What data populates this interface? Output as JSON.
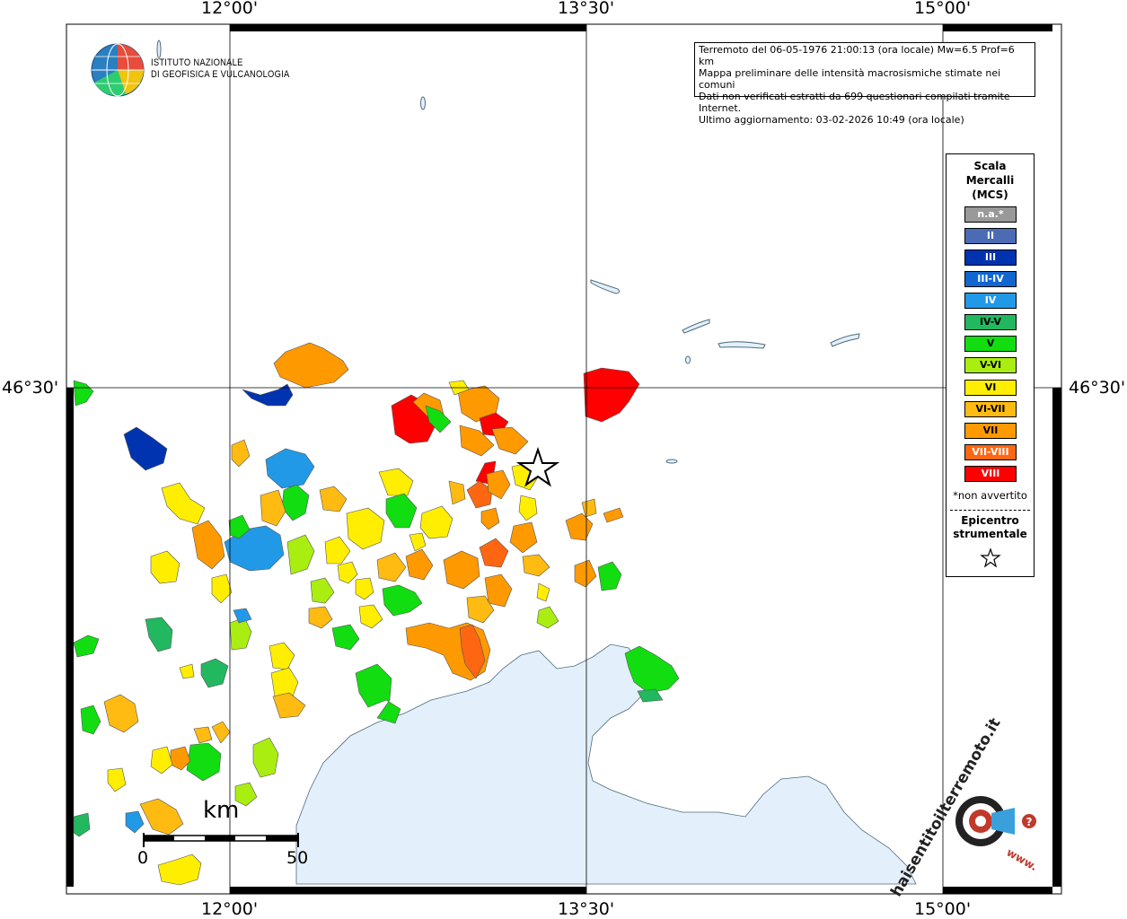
{
  "axes": {
    "top": [
      "12°00'",
      "13°30'",
      "15°00'"
    ],
    "bottom": [
      "12°00'",
      "13°30'",
      "15°00'"
    ],
    "left": "46°30'",
    "right": "46°30'"
  },
  "logo": {
    "line1": "ISTITUTO NAZIONALE",
    "line2": "DI GEOFISICA E VULCANOLOGIA"
  },
  "info_box": {
    "line1": "Terremoto del 06-05-1976 21:00:13 (ora locale) Mw=6.5 Prof=6 km",
    "line2": "Mappa preliminare delle intensità macrosismiche stimate nei comuni",
    "line3": "Dati non verificati estratti da 699 questionari compilati tramite Internet.",
    "line4": "Ultimo aggiornamento: 03-02-2026 10:49 (ora locale)"
  },
  "legend": {
    "title_line1": "Scala",
    "title_line2": "Mercalli",
    "title_line3": "(MCS)",
    "classes": [
      {
        "label": "n.a.*",
        "color": "#999999"
      },
      {
        "label": "II",
        "color": "#4b6bb5"
      },
      {
        "label": "III",
        "color": "#0033b0"
      },
      {
        "label": "III-IV",
        "color": "#1166d0"
      },
      {
        "label": "IV",
        "color": "#2299e6"
      },
      {
        "label": "IV-V",
        "color": "#22b860"
      },
      {
        "label": "V",
        "color": "#11dd11"
      },
      {
        "label": "V-VI",
        "color": "#aaee11"
      },
      {
        "label": "VI",
        "color": "#ffee00"
      },
      {
        "label": "VI-VII",
        "color": "#ffbb11"
      },
      {
        "label": "VII",
        "color": "#ff9900"
      },
      {
        "label": "VII-VIII",
        "color": "#ff6611"
      },
      {
        "label": "VIII",
        "color": "#ff0000"
      }
    ],
    "not_felt_note": "*non avvertito",
    "epicenter_line1": "Epicentro",
    "epicenter_line2": "strumentale"
  },
  "scale_bar": {
    "unit": "km",
    "start": "0",
    "end": "50"
  },
  "watermark": {
    "text": "haisentitoilterremoto.it",
    "sub": "www."
  },
  "colors": {
    "sea": "#e3f0fb",
    "coast": "#4d6b7a",
    "grid": "#000000"
  }
}
